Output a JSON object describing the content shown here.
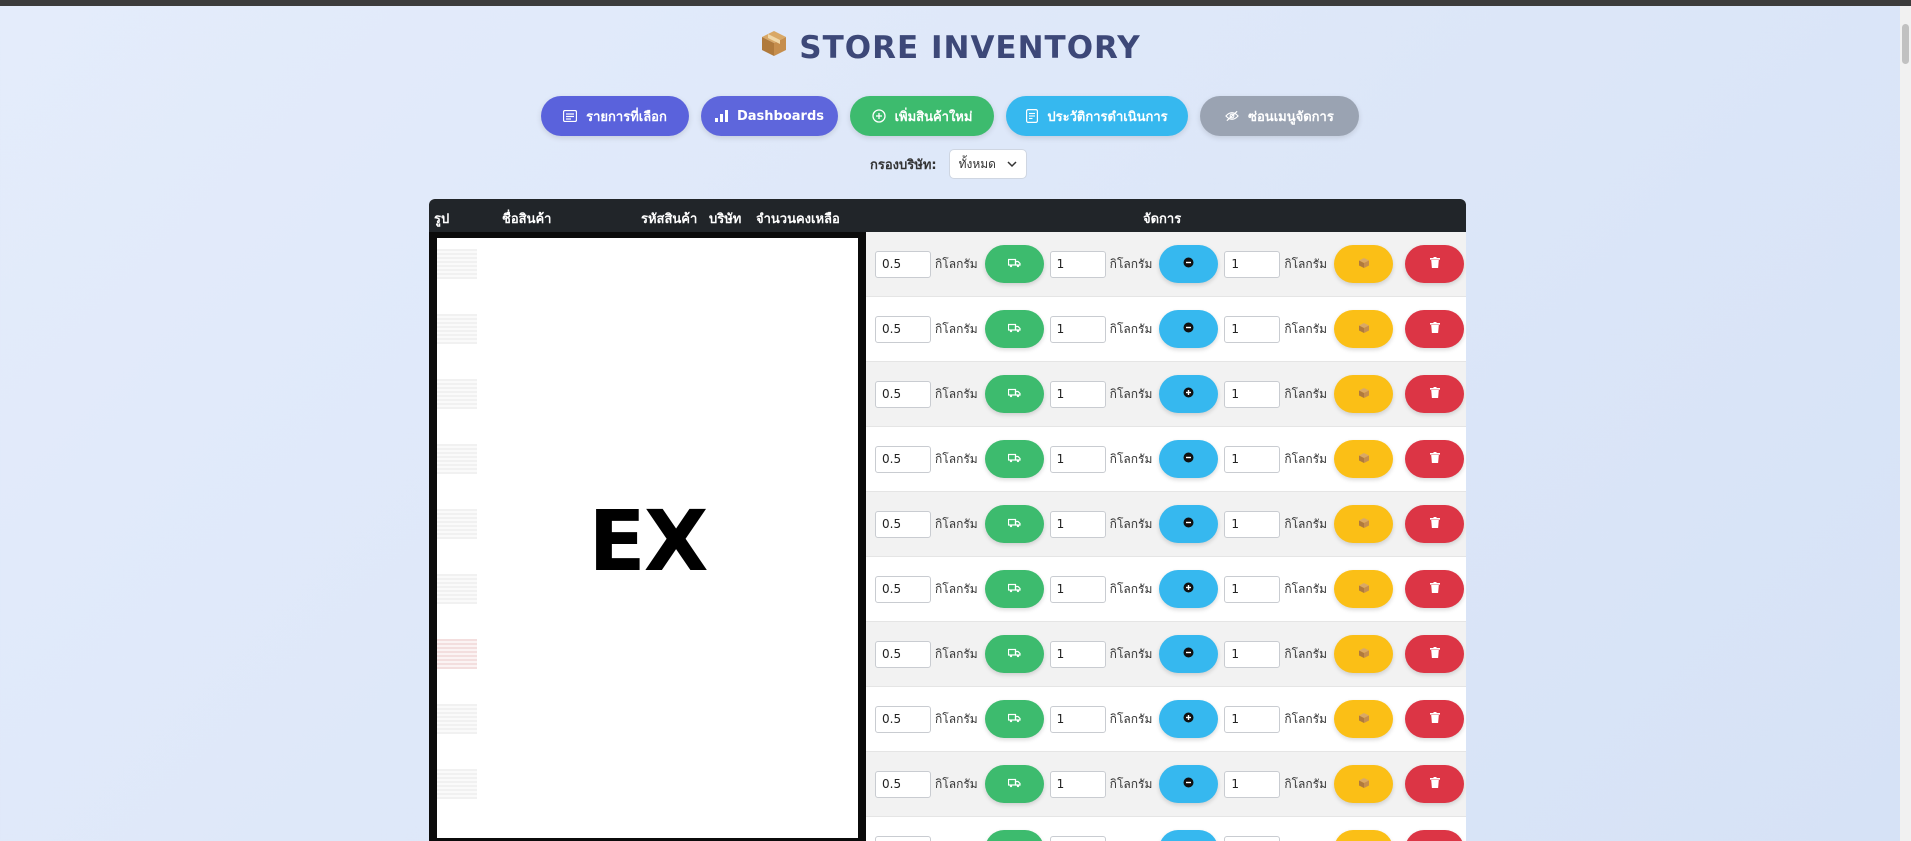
{
  "header": {
    "title": "STORE INVENTORY",
    "title_icon": "box-icon"
  },
  "nav": {
    "buttons": [
      {
        "label": "รายการที่เลือก",
        "icon": "list-icon",
        "color": "#5a62dc"
      },
      {
        "label": "Dashboards",
        "icon": "bar-chart-icon",
        "color": "#5e66dc"
      },
      {
        "label": "เพิ่มสินค้าใหม่",
        "icon": "plus-circle-icon",
        "color": "#3dbb6e"
      },
      {
        "label": "ประวัติการดำเนินการ",
        "icon": "document-icon",
        "color": "#36b8ef"
      },
      {
        "label": "ซ่อนเมนูจัดการ",
        "icon": "eye-off-icon",
        "color": "#9aa3b2"
      }
    ]
  },
  "filter": {
    "label": "กรองบริษัท:",
    "selected": "ทั้งหมด"
  },
  "table": {
    "columns": [
      "รูป",
      "ชื่อสินค้า",
      "รหัสสินค้า",
      "บริษัท",
      "จำนวนคงเหลือ",
      "จัดการ"
    ],
    "redaction_text": "EX",
    "unit_label": "กิโลกรัม",
    "rows": [
      {
        "ship_qty": "0.5",
        "adjust_qty": "1",
        "pack_qty": "1",
        "adjust_sign": "minus"
      },
      {
        "ship_qty": "0.5",
        "adjust_qty": "1",
        "pack_qty": "1",
        "adjust_sign": "minus"
      },
      {
        "ship_qty": "0.5",
        "adjust_qty": "1",
        "pack_qty": "1",
        "adjust_sign": "plus"
      },
      {
        "ship_qty": "0.5",
        "adjust_qty": "1",
        "pack_qty": "1",
        "adjust_sign": "minus"
      },
      {
        "ship_qty": "0.5",
        "adjust_qty": "1",
        "pack_qty": "1",
        "adjust_sign": "minus"
      },
      {
        "ship_qty": "0.5",
        "adjust_qty": "1",
        "pack_qty": "1",
        "adjust_sign": "plus"
      },
      {
        "ship_qty": "0.5",
        "adjust_qty": "1",
        "pack_qty": "1",
        "adjust_sign": "minus"
      },
      {
        "ship_qty": "0.5",
        "adjust_qty": "1",
        "pack_qty": "1",
        "adjust_sign": "plus"
      },
      {
        "ship_qty": "0.5",
        "adjust_qty": "1",
        "pack_qty": "1",
        "adjust_sign": "minus"
      },
      {
        "ship_qty": "",
        "adjust_qty": "",
        "pack_qty": "",
        "adjust_sign": "minus"
      }
    ]
  },
  "colors": {
    "ship_button": "#3dbb6e",
    "adjust_button": "#36b8ef",
    "pack_button": "#fbbf16",
    "delete_button": "#dc3545"
  }
}
